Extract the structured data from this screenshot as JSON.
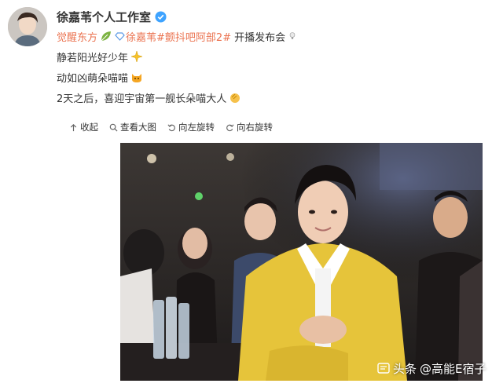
{
  "post": {
    "username": "徐嘉苇个人工作室",
    "tag_brand": "觉醒东方",
    "mention": "徐嘉苇",
    "topic": "#颤抖吧阿部2#",
    "line1_suffix": "开播发布会",
    "line2": "静若阳光好少年",
    "line3": "动如凶萌朵喵喵",
    "line4": "2天之后，喜迎宇宙第一舰长朵喵大人"
  },
  "toolbar": {
    "collapse_label": "收起",
    "view_large_label": "查看大图",
    "rotate_left_label": "向左旋转",
    "rotate_right_label": "向右旋转"
  },
  "watermark": {
    "platform": "头条",
    "author": "@高能E宿子"
  },
  "icons": {
    "verified": "verified-badge-icon",
    "emoji_brand": "leaf-icon",
    "emoji_sun": "sparkle-icon",
    "emoji_cat": "cat-icon",
    "emoji_clap": "clap-icon"
  },
  "colors": {
    "link": "#eb7350",
    "verified": "#3ea3ff",
    "jacket": "#e6c43a"
  }
}
